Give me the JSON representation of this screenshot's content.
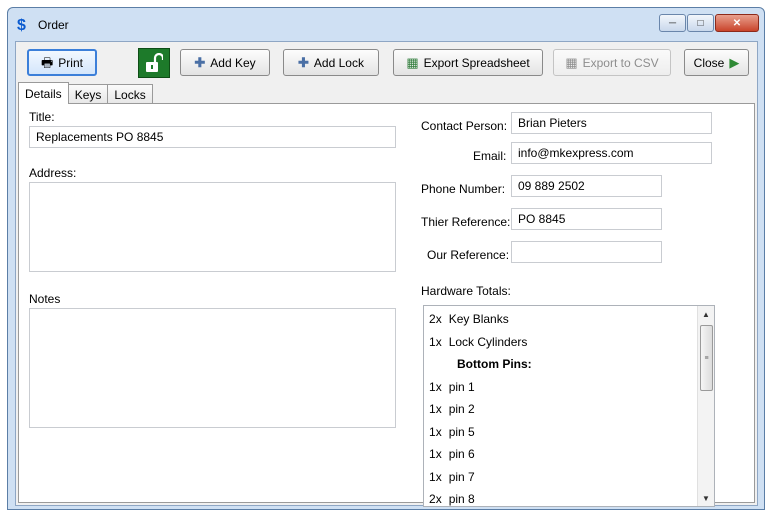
{
  "window": {
    "title": "Order",
    "app_icon": "dollar-icon"
  },
  "toolbar": {
    "print_label": "Print",
    "add_key_label": "Add Key",
    "add_lock_label": "Add Lock",
    "export_spreadsheet_label": "Export Spreadsheet",
    "export_csv_label": "Export to CSV",
    "close_label": "Close"
  },
  "tabs": [
    {
      "label": "Details",
      "active": true
    },
    {
      "label": "Keys",
      "active": false
    },
    {
      "label": "Locks",
      "active": false
    }
  ],
  "details": {
    "title_label": "Title:",
    "title_value": "Replacements PO 8845",
    "address_label": "Address:",
    "notes_label": "Notes",
    "contact_label": "Contact Person:",
    "contact_value": "Brian Pieters",
    "email_label": "Email:",
    "email_value": "info@mkexpress.com",
    "phone_label": "Phone Number:",
    "phone_value": "09 889 2502",
    "their_ref_label": "Thier Reference:",
    "their_ref_value": "PO 8845",
    "our_ref_label": "Our Reference:",
    "our_ref_value": "",
    "hardware_label": "Hardware Totals:"
  },
  "hardware": [
    {
      "qty": "2",
      "x": "x",
      "item": "Key Blanks"
    },
    {
      "qty": "1",
      "x": "x",
      "item": "Lock Cylinders"
    },
    {
      "header": "Bottom Pins:"
    },
    {
      "qty": "1",
      "x": "x",
      "item": "pin 1"
    },
    {
      "qty": "1",
      "x": "x",
      "item": "pin 2"
    },
    {
      "qty": "1",
      "x": "x",
      "item": "pin 5"
    },
    {
      "qty": "1",
      "x": "x",
      "item": "pin 6"
    },
    {
      "qty": "1",
      "x": "x",
      "item": "pin 7"
    },
    {
      "qty": "2",
      "x": "x",
      "item": "pin 8"
    }
  ],
  "colors": {
    "unlock_bg": "#1d7a2a",
    "active_button_border": "#3c7fd9",
    "close_button": "#c9442b"
  }
}
